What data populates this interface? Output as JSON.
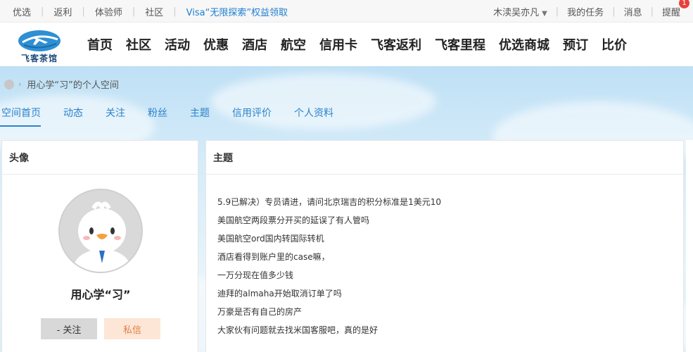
{
  "topbar": {
    "left_links": [
      {
        "label": "优选"
      },
      {
        "label": "返利"
      },
      {
        "label": "体验师"
      },
      {
        "label": "社区"
      },
      {
        "label": "Visa“无限探索”权益领取"
      }
    ],
    "username": "木渎吴亦凡",
    "my_tasks": "我的任务",
    "messages": "消息",
    "reminders": "提醒",
    "reminder_count": "1"
  },
  "header": {
    "logo_text": "飞客茶馆",
    "nav": [
      {
        "label": "首页"
      },
      {
        "label": "社区"
      },
      {
        "label": "活动"
      },
      {
        "label": "优惠"
      },
      {
        "label": "酒店"
      },
      {
        "label": "航空"
      },
      {
        "label": "信用卡"
      },
      {
        "label": "飞客返利"
      },
      {
        "label": "飞客里程"
      },
      {
        "label": "优选商城"
      },
      {
        "label": "预订"
      },
      {
        "label": "比价"
      }
    ]
  },
  "breadcrumb": {
    "current": "用心学“习”的个人空间"
  },
  "space_tabs": [
    {
      "label": "空间首页"
    },
    {
      "label": "动态"
    },
    {
      "label": "关注"
    },
    {
      "label": "粉丝"
    },
    {
      "label": "主题"
    },
    {
      "label": "信用评价"
    },
    {
      "label": "个人资料"
    }
  ],
  "profile": {
    "heading": "头像",
    "name": "用心学“习”",
    "follow_label": "- 关注",
    "message_label": "私信"
  },
  "topics": {
    "heading": "主题",
    "items": [
      "5.9已解决）专员请进，请问北京瑞吉的积分标准是1美元10",
      "美国航空两段票分开买的延误了有人管吗",
      "美国航空ord国内转国际转机",
      "酒店看得到账户里的case嘛，",
      "一万分现在值多少钱",
      "迪拜的almaha开始取消订单了吗",
      "万豪是否有自己的房产",
      "大家伙有问题就去找米国客服吧，真的是好"
    ]
  },
  "colors": {
    "accent": "#2b82cc",
    "visa_link": "#1f7fd1",
    "badge": "#e8413a",
    "message_button_bg": "#fde6d6",
    "message_button_text": "#e07f46"
  }
}
